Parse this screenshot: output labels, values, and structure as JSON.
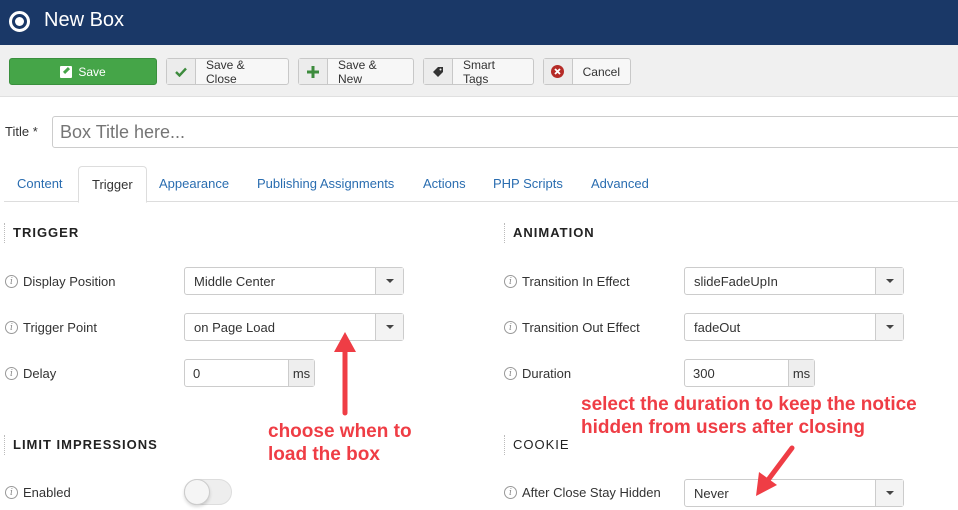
{
  "header": {
    "title": "New Box",
    "icon": "target-icon"
  },
  "toolbar": {
    "save": {
      "label": "Save",
      "icon": "edit-icon",
      "color": "#45a548"
    },
    "save_close": {
      "label": "Save & Close",
      "icon": "check-icon"
    },
    "save_new": {
      "label": "Save & New",
      "icon": "plus-icon"
    },
    "smart_tags": {
      "label": "Smart Tags",
      "icon": "tag-icon"
    },
    "cancel": {
      "label": "Cancel",
      "icon": "cancel-circle-icon"
    }
  },
  "title_field": {
    "label": "Title *",
    "placeholder": "Box Title here..."
  },
  "tabs": [
    {
      "label": "Content",
      "active": false
    },
    {
      "label": "Trigger",
      "active": true
    },
    {
      "label": "Appearance",
      "active": false
    },
    {
      "label": "Publishing Assignments",
      "active": false
    },
    {
      "label": "Actions",
      "active": false
    },
    {
      "label": "PHP Scripts",
      "active": false
    },
    {
      "label": "Advanced",
      "active": false
    }
  ],
  "trigger": {
    "heading": "TRIGGER",
    "display_position": {
      "label": "Display Position",
      "value": "Middle Center"
    },
    "trigger_point": {
      "label": "Trigger Point",
      "value": "on Page Load"
    },
    "delay": {
      "label": "Delay",
      "value": "0",
      "unit": "ms"
    }
  },
  "limit_impressions": {
    "heading": "LIMIT IMPRESSIONS",
    "enabled": {
      "label": "Enabled",
      "value": false
    }
  },
  "animation": {
    "heading": "ANIMATION",
    "transition_in": {
      "label": "Transition In Effect",
      "value": "slideFadeUpIn"
    },
    "transition_out": {
      "label": "Transition Out Effect",
      "value": "fadeOut"
    },
    "duration": {
      "label": "Duration",
      "value": "300",
      "unit": "ms"
    }
  },
  "cookie": {
    "heading": "COOKIE",
    "after_close": {
      "label": "After Close Stay Hidden",
      "value": "Never"
    }
  },
  "annotations": {
    "trigger_note_line1": "choose when to",
    "trigger_note_line2": "load the box",
    "cookie_note_line1": "select the duration to keep the notice",
    "cookie_note_line2": "hidden from users after closing",
    "color": "#ef3d45"
  }
}
